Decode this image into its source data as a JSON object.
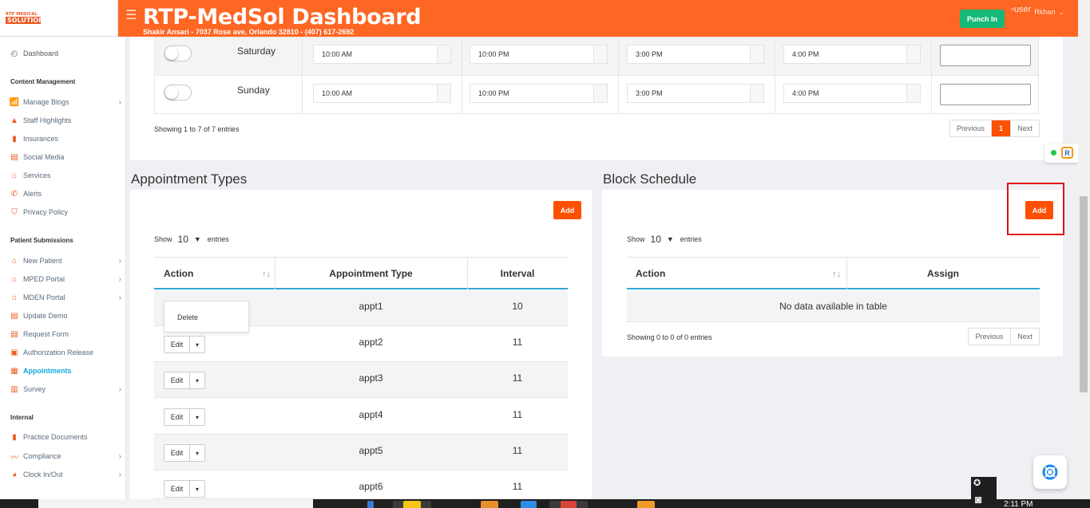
{
  "header": {
    "logo_top": "RTP MEDICAL",
    "logo_main": "SOLUTION",
    "title": "RTP-MedSol Dashboard",
    "subtitle": "Shakir Ansari - 7037 Rose ave, Orlando 32810 - (407) 617-2692",
    "punch_in": "Punch In",
    "user_img_alt": "user",
    "user_name": "Rkhan",
    "caret": "⌄"
  },
  "sidebar": {
    "dashboard": "Dashboard",
    "sections": [
      {
        "title": "Content Management"
      },
      {
        "title": "Patient Submissions"
      },
      {
        "title": "Internal"
      }
    ],
    "content_items": [
      "Manage Blogs",
      "Staff Highlights",
      "Insurances",
      "Social Media",
      "Services",
      "Alerts",
      "Privacy Policy"
    ],
    "patient_items": [
      "New Patient",
      "MPED Portal",
      "MDEN Portal",
      "Update Demo",
      "Request Form",
      "Authorization Release",
      "Appointments",
      "Survey"
    ],
    "internal_items": [
      "Practice Documents",
      "Compliance",
      "Clock In/Out"
    ]
  },
  "schedule": {
    "rows": [
      {
        "day": "Saturday",
        "t1": "10:00 AM",
        "t2": "10:00 PM",
        "t3": "3:00 PM",
        "t4": "4:00 PM"
      },
      {
        "day": "Sunday",
        "t1": "10:00 AM",
        "t2": "10:00 PM",
        "t3": "3:00 PM",
        "t4": "4:00 PM"
      }
    ],
    "info": "Showing 1 to 7 of 7 entries",
    "prev": "Previous",
    "page": "1",
    "next": "Next"
  },
  "appointment_types": {
    "title": "Appointment Types",
    "add": "Add",
    "show": "Show",
    "show_count": "10",
    "entries": "entries",
    "headers": {
      "action": "Action",
      "type": "Appointment Type",
      "interval": "Interval"
    },
    "rows": [
      {
        "type": "appt1",
        "interval": "10"
      },
      {
        "type": "appt2",
        "interval": "11"
      },
      {
        "type": "appt3",
        "interval": "11"
      },
      {
        "type": "appt4",
        "interval": "11"
      },
      {
        "type": "appt5",
        "interval": "11"
      },
      {
        "type": "appt6",
        "interval": "11"
      }
    ],
    "edit": "Edit",
    "dropdown_delete": "Delete"
  },
  "block_schedule": {
    "title": "Block Schedule",
    "add": "Add",
    "show": "Show",
    "show_count": "10",
    "entries": "entries",
    "headers": {
      "action": "Action",
      "assign": "Assign"
    },
    "empty": "No data available in table",
    "info": "Showing 0 to 0 of 0 entries",
    "prev": "Previous",
    "next": "Next"
  },
  "taskbar": {
    "clock": "2:11 PM"
  },
  "colors": {
    "brand": "#fe6623",
    "accent": "#fe5000",
    "punch": "#17b978",
    "active_link": "#11a7dc",
    "table_border": "#2fa8d6"
  }
}
